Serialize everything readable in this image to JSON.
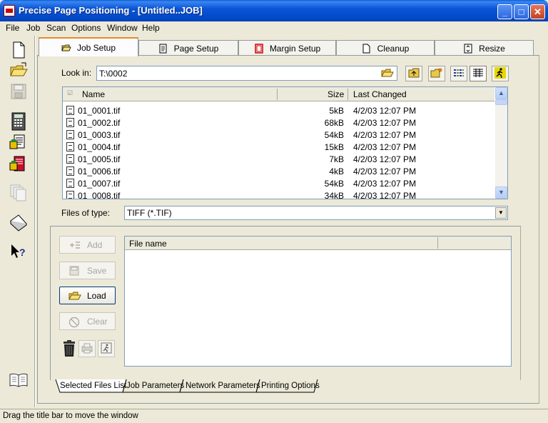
{
  "window": {
    "title": "Precise Page Positioning - [Untitled..JOB]"
  },
  "menu": [
    "File",
    "Job",
    "Scan",
    "Options",
    "Window",
    "Help"
  ],
  "left_toolbar": [
    "new-document-icon",
    "open-folder-icon",
    "save-disk-icon",
    "calculator-icon",
    "scan-pages-icon",
    "scan-red-icon",
    "copy-pages-icon",
    "scanner-icon",
    "help-pointer-icon",
    "book-icon"
  ],
  "tabs": [
    {
      "label": "Job Setup",
      "icon": "folder-icon"
    },
    {
      "label": "Page Setup",
      "icon": "page-icon"
    },
    {
      "label": "Margin Setup",
      "icon": "margin-icon"
    },
    {
      "label": "Cleanup",
      "icon": "blank-page-icon"
    },
    {
      "label": "Resize",
      "icon": "resize-icon"
    }
  ],
  "look_in": {
    "label": "Look in:",
    "value": "T:\\0002"
  },
  "file_list": {
    "columns": [
      "Name",
      "Size",
      "Last Changed"
    ],
    "rows": [
      {
        "name": "01_0001.tif",
        "size": "5kB",
        "changed": "4/2/03 12:07 PM"
      },
      {
        "name": "01_0002.tif",
        "size": "68kB",
        "changed": "4/2/03 12:07 PM"
      },
      {
        "name": "01_0003.tif",
        "size": "54kB",
        "changed": "4/2/03 12:07 PM"
      },
      {
        "name": "01_0004.tif",
        "size": "15kB",
        "changed": "4/2/03 12:07 PM"
      },
      {
        "name": "01_0005.tif",
        "size": "7kB",
        "changed": "4/2/03 12:07 PM"
      },
      {
        "name": "01_0006.tif",
        "size": "4kB",
        "changed": "4/2/03 12:07 PM"
      },
      {
        "name": "01_0007.tif",
        "size": "54kB",
        "changed": "4/2/03 12:07 PM"
      },
      {
        "name": "01_0008.tif",
        "size": "34kB",
        "changed": "4/2/03 12:07 PM"
      }
    ]
  },
  "files_of_type": {
    "label": "Files of type:",
    "value": "TIFF (*.TIF)"
  },
  "actions": {
    "add": "Add",
    "save": "Save",
    "load": "Load",
    "clear": "Clear"
  },
  "selected_list": {
    "column": "File name"
  },
  "bottom_tabs": [
    "Selected Files List",
    "Job Parameters",
    "Network Parameters",
    "Printing Options"
  ],
  "status": "Drag the title bar to move the window"
}
